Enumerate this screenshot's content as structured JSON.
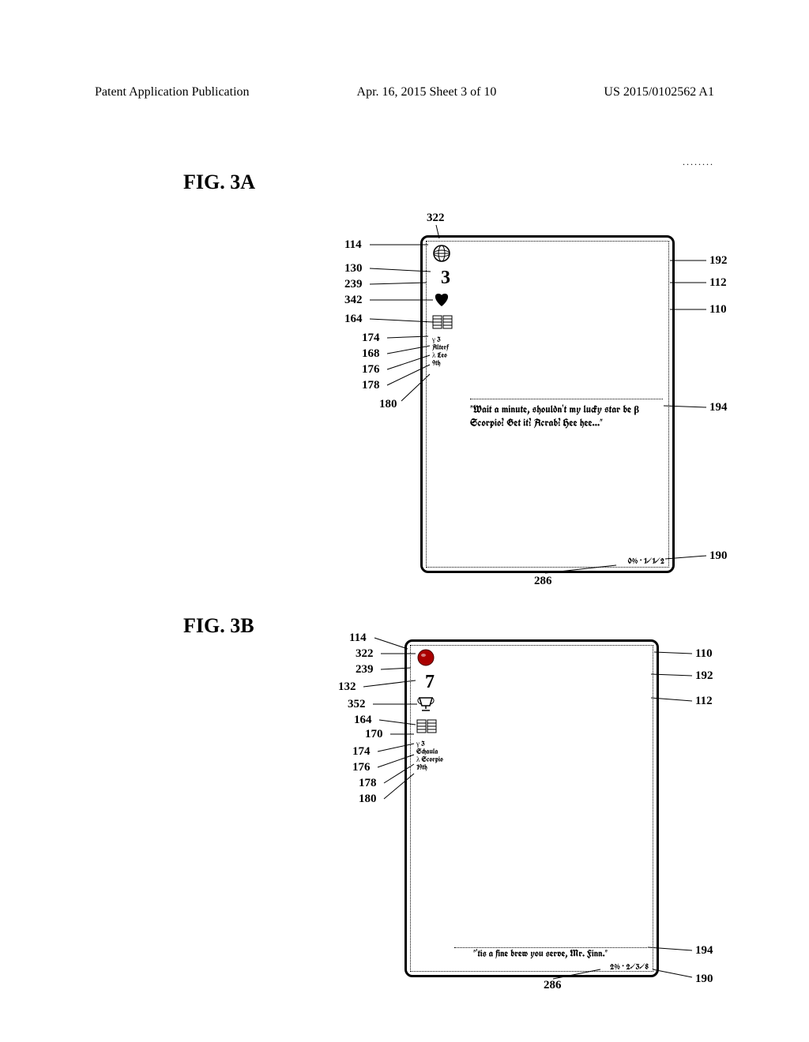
{
  "header": {
    "left": "Patent Application Publication",
    "center": "Apr. 16, 2015  Sheet 3 of 10",
    "right": "US 2015/0102562 A1"
  },
  "dots": "........",
  "figA": {
    "label": "FIG. 3A",
    "refs_left": {
      "r114": "114",
      "r130": "130",
      "r239": "239",
      "r342": "342",
      "r164": "164",
      "r174": "174",
      "r168": "168",
      "r176": "176",
      "r178": "178",
      "r180": "180"
    },
    "refs_top": {
      "r322": "322"
    },
    "refs_right": {
      "r192": "192",
      "r112": "112",
      "r110": "110",
      "r194": "194",
      "r190": "190"
    },
    "refs_bottom": {
      "r286": "286"
    },
    "sidebar": {
      "rank": "3",
      "star_line": "γ 3",
      "name": "Alterf",
      "constellation": "λ Leo",
      "day": "9th"
    },
    "quote": "\"Wait a minute, shouldn't my lucky star be β Scorpio? Get it? Acrab? Hee hee...\"",
    "status": "0% · 1/1/2"
  },
  "figB": {
    "label": "FIG. 3B",
    "refs_left": {
      "r114": "114",
      "r322": "322",
      "r239": "239",
      "r132": "132",
      "r352": "352",
      "r164": "164",
      "r170": "170",
      "r174": "174",
      "r176": "176",
      "r178": "178",
      "r180": "180"
    },
    "refs_right": {
      "r110": "110",
      "r192": "192",
      "r112": "112",
      "r194": "194",
      "r190": "190"
    },
    "refs_bottom": {
      "r286": "286"
    },
    "sidebar": {
      "rank": "7",
      "star_line": "γ 3",
      "name": "Schaula",
      "constellation": "λ Scorpio",
      "day": "19th"
    },
    "quote": "\"'tis a fine brew you serve, Mr. Finn.\"",
    "status": "2% · 2/3/8"
  }
}
